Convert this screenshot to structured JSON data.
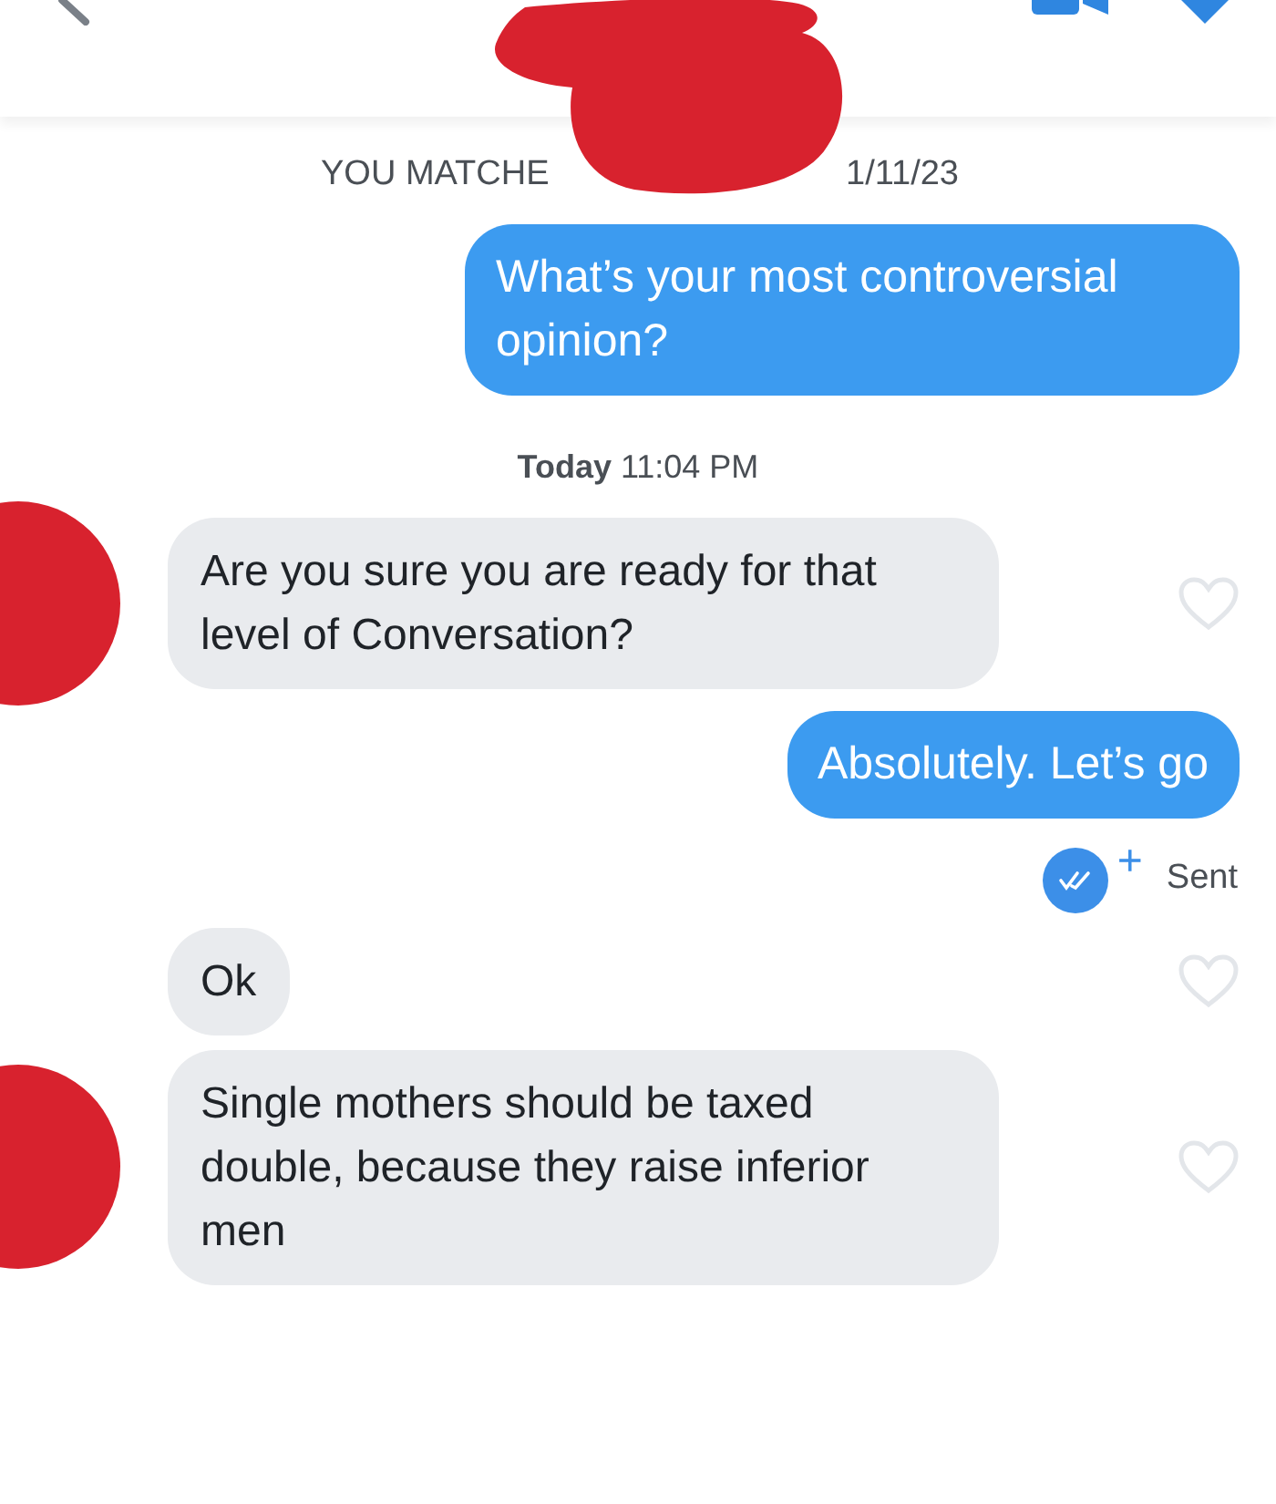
{
  "match_notice": {
    "before": "YOU MATCHE",
    "after": "1/11/23"
  },
  "messages": [
    {
      "kind": "outgoing",
      "text": "What’s your most controversial opinion?"
    },
    {
      "kind": "timestamp",
      "text": "**Today** 11:04 PM"
    },
    {
      "kind": "incoming",
      "text": "Are you sure you are ready for that level of Conversation?",
      "avatar": true,
      "liked": false
    },
    {
      "kind": "outgoing",
      "text": "Absolutely. Let’s go"
    },
    {
      "kind": "status",
      "text": "Sent",
      "plus": "+"
    },
    {
      "kind": "incoming",
      "text": "Ok",
      "avatar": false,
      "liked": false
    },
    {
      "kind": "incoming",
      "text": "Single mothers should be taxed double, because they raise inferior men",
      "avatar": true,
      "liked": false
    }
  ]
}
